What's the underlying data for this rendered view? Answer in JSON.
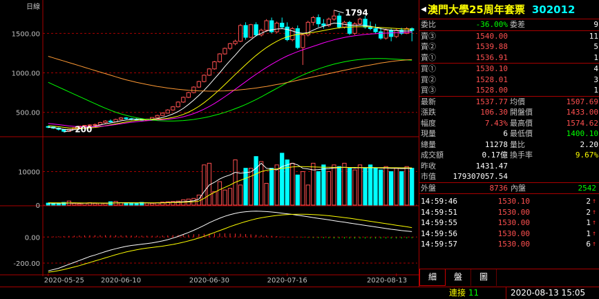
{
  "chart": {
    "period_label": "日線",
    "price_ticks": [
      "1500.00",
      "1000.00",
      "500.00"
    ],
    "volume_ticks": [
      "10000",
      "0"
    ],
    "macd_ticks": [
      "0.00",
      "-200.00"
    ],
    "date_ticks": [
      "2020-05-25",
      "2020-06-10",
      "2020-06-30",
      "2020-07-16",
      "2020-08-13"
    ],
    "high_label": "1794",
    "low_label": "200"
  },
  "chart_data": {
    "type": "candlestick",
    "price_ylim": [
      200,
      1800
    ],
    "candles": [
      [
        320,
        330,
        300,
        315
      ],
      [
        315,
        320,
        290,
        300
      ],
      [
        300,
        310,
        270,
        285
      ],
      [
        285,
        290,
        250,
        260
      ],
      [
        260,
        290,
        250,
        285
      ],
      [
        285,
        310,
        280,
        305
      ],
      [
        305,
        330,
        300,
        325
      ],
      [
        325,
        340,
        320,
        335
      ],
      [
        335,
        350,
        325,
        340
      ],
      [
        340,
        360,
        330,
        345
      ],
      [
        345,
        380,
        340,
        370
      ],
      [
        370,
        400,
        360,
        390
      ],
      [
        390,
        410,
        370,
        380
      ],
      [
        380,
        420,
        375,
        410
      ],
      [
        410,
        440,
        400,
        430
      ],
      [
        430,
        440,
        410,
        420
      ],
      [
        420,
        430,
        400,
        415
      ],
      [
        415,
        425,
        400,
        410
      ],
      [
        410,
        420,
        395,
        400
      ],
      [
        400,
        420,
        390,
        415
      ],
      [
        415,
        440,
        410,
        435
      ],
      [
        435,
        470,
        430,
        460
      ],
      [
        460,
        500,
        455,
        490
      ],
      [
        490,
        540,
        485,
        530
      ],
      [
        530,
        580,
        520,
        570
      ],
      [
        570,
        640,
        560,
        630
      ],
      [
        630,
        700,
        620,
        690
      ],
      [
        690,
        760,
        680,
        750
      ],
      [
        750,
        830,
        740,
        820
      ],
      [
        820,
        900,
        810,
        890
      ],
      [
        890,
        980,
        880,
        970
      ],
      [
        970,
        1060,
        960,
        1050
      ],
      [
        1050,
        1150,
        1040,
        1140
      ],
      [
        1140,
        1250,
        1130,
        1240
      ],
      [
        1240,
        1320,
        1230,
        1310
      ],
      [
        1310,
        1380,
        1290,
        1370
      ],
      [
        1370,
        1420,
        1350,
        1400
      ],
      [
        1400,
        1620,
        1390,
        1600
      ],
      [
        1600,
        1640,
        1420,
        1450
      ],
      [
        1450,
        1620,
        1440,
        1610
      ],
      [
        1610,
        1640,
        1460,
        1480
      ],
      [
        1480,
        1560,
        1460,
        1540
      ],
      [
        1540,
        1680,
        1520,
        1660
      ],
      [
        1660,
        1700,
        1500,
        1520
      ],
      [
        1520,
        1650,
        1500,
        1630
      ],
      [
        1630,
        1700,
        1560,
        1580
      ],
      [
        1580,
        1640,
        1400,
        1420
      ],
      [
        1420,
        1580,
        1400,
        1560
      ],
      [
        1560,
        1600,
        1300,
        1320
      ],
      [
        1320,
        1500,
        1100,
        1480
      ],
      [
        1480,
        1660,
        1460,
        1640
      ],
      [
        1640,
        1720,
        1600,
        1700
      ],
      [
        1700,
        1740,
        1580,
        1620
      ],
      [
        1620,
        1680,
        1560,
        1600
      ],
      [
        1600,
        1700,
        1580,
        1680
      ],
      [
        1680,
        1794,
        1660,
        1720
      ],
      [
        1720,
        1760,
        1560,
        1580
      ],
      [
        1580,
        1660,
        1560,
        1640
      ],
      [
        1640,
        1660,
        1480,
        1500
      ],
      [
        1500,
        1640,
        1480,
        1620
      ],
      [
        1620,
        1700,
        1600,
        1680
      ],
      [
        1680,
        1720,
        1560,
        1580
      ],
      [
        1580,
        1650,
        1540,
        1560
      ],
      [
        1560,
        1620,
        1500,
        1520
      ],
      [
        1520,
        1570,
        1420,
        1440
      ],
      [
        1440,
        1560,
        1420,
        1540
      ],
      [
        1540,
        1560,
        1400,
        1460
      ],
      [
        1460,
        1560,
        1440,
        1540
      ],
      [
        1540,
        1570,
        1480,
        1500
      ],
      [
        1500,
        1580,
        1490,
        1560
      ],
      [
        1560,
        1575,
        1400,
        1537
      ]
    ],
    "ma_lines": [
      {
        "color": "#ffffff",
        "values": [
          310,
          305,
          295,
          285,
          280,
          282,
          290,
          300,
          312,
          325,
          340,
          355,
          365,
          378,
          392,
          402,
          410,
          414,
          412,
          410,
          412,
          420,
          435,
          455,
          480,
          510,
          550,
          600,
          655,
          715,
          780,
          850,
          925,
          1000,
          1080,
          1155,
          1225,
          1300,
          1370,
          1420,
          1470,
          1500,
          1530,
          1545,
          1555,
          1560,
          1550,
          1530,
          1510,
          1500,
          1510,
          1540,
          1570,
          1590,
          1610,
          1630,
          1625,
          1615,
          1605,
          1600,
          1605,
          1600,
          1590,
          1575,
          1560,
          1550,
          1540,
          1535,
          1530,
          1530,
          1532
        ]
      },
      {
        "color": "#ffff00",
        "values": [
          330,
          325,
          318,
          310,
          302,
          298,
          296,
          298,
          302,
          308,
          318,
          330,
          342,
          354,
          366,
          378,
          390,
          398,
          404,
          408,
          410,
          412,
          416,
          424,
          436,
          452,
          474,
          502,
          536,
          576,
          622,
          674,
          730,
          790,
          852,
          916,
          980,
          1042,
          1104,
          1164,
          1220,
          1272,
          1320,
          1362,
          1400,
          1432,
          1456,
          1474,
          1486,
          1494,
          1502,
          1512,
          1524,
          1536,
          1548,
          1560,
          1570,
          1576,
          1580,
          1582,
          1584,
          1584,
          1582,
          1578,
          1574,
          1570,
          1566,
          1562,
          1558,
          1555,
          1552
        ]
      },
      {
        "color": "#ff00ff",
        "values": [
          360,
          352,
          344,
          336,
          328,
          322,
          318,
          316,
          316,
          318,
          322,
          328,
          336,
          345,
          355,
          365,
          374,
          382,
          388,
          394,
          398,
          402,
          406,
          412,
          420,
          430,
          444,
          462,
          484,
          510,
          540,
          574,
          612,
          654,
          698,
          744,
          792,
          840,
          888,
          936,
          982,
          1026,
          1068,
          1108,
          1146,
          1182,
          1214,
          1242,
          1268,
          1292,
          1314,
          1336,
          1358,
          1380,
          1400,
          1418,
          1434,
          1448,
          1460,
          1470,
          1478,
          1486,
          1492,
          1497,
          1500,
          1503,
          1506,
          1508,
          1510,
          1512,
          1514
        ]
      },
      {
        "color": "#00ff00",
        "values": [
          880,
          850,
          820,
          790,
          760,
          730,
          700,
          670,
          640,
          610,
          580,
          552,
          526,
          502,
          480,
          462,
          446,
          432,
          420,
          410,
          402,
          396,
          392,
          390,
          390,
          392,
          396,
          402,
          410,
          420,
          432,
          446,
          462,
          480,
          500,
          522,
          546,
          572,
          600,
          630,
          662,
          696,
          732,
          768,
          804,
          840,
          876,
          910,
          942,
          972,
          1000,
          1026,
          1050,
          1072,
          1092,
          1110,
          1126,
          1140,
          1152,
          1162,
          1170,
          1176,
          1180,
          1182,
          1182,
          1180,
          1176,
          1172,
          1168,
          1164,
          1160
        ]
      },
      {
        "color": "#ff9933",
        "values": [
          1210,
          1190,
          1170,
          1150,
          1130,
          1110,
          1090,
          1070,
          1050,
          1030,
          1010,
          990,
          970,
          950,
          930,
          912,
          896,
          880,
          866,
          852,
          840,
          828,
          818,
          808,
          800,
          792,
          786,
          780,
          776,
          772,
          770,
          768,
          768,
          770,
          772,
          776,
          780,
          786,
          792,
          800,
          808,
          818,
          828,
          840,
          852,
          864,
          878,
          892,
          906,
          920,
          934,
          948,
          962,
          976,
          990,
          1004,
          1018,
          1032,
          1046,
          1060,
          1074,
          1088,
          1100,
          1112,
          1124,
          1134,
          1144,
          1152,
          1158,
          1164,
          1168
        ]
      }
    ],
    "volume_ylim": [
      0,
      20000
    ],
    "volume": [
      600,
      500,
      400,
      800,
      1200,
      500,
      400,
      600,
      700,
      500,
      600,
      500,
      1000,
      1100,
      700,
      600,
      700,
      500,
      800,
      600,
      500,
      700,
      900,
      1000,
      1100,
      1200,
      1600,
      1800,
      2000,
      3000,
      12000,
      12500,
      4000,
      7000,
      4500,
      5000,
      13500,
      6000,
      11000,
      11000,
      14500,
      13000,
      6500,
      11000,
      12000,
      15500,
      13500,
      12500,
      9000,
      10000,
      6000,
      12500,
      10000,
      12000,
      10000,
      12000,
      11500,
      12500,
      11000,
      10500,
      12000,
      11000,
      12000,
      11000,
      10500,
      11500,
      10000,
      11000,
      10000,
      11500,
      11000
    ],
    "vol_ma_lines": [
      {
        "color": "#ffffff",
        "values": [
          600,
          580,
          560,
          580,
          600,
          620,
          580,
          560,
          600,
          620,
          580,
          560,
          600,
          650,
          700,
          720,
          700,
          680,
          700,
          650,
          620,
          640,
          700,
          780,
          850,
          920,
          1000,
          1120,
          1300,
          1800,
          4000,
          6000,
          6800,
          7800,
          8500,
          9000,
          9800,
          9500,
          9700,
          9900,
          11000,
          12500,
          11000,
          10800,
          10500,
          11500,
          12000,
          12500,
          12000,
          11000,
          10800,
          10500,
          10600,
          10800,
          10900,
          11100,
          11200,
          11300,
          11200,
          11100,
          11200,
          11150,
          11200,
          11150,
          11050,
          11100,
          11000,
          11000,
          10900,
          10950,
          10950
        ]
      },
      {
        "color": "#ffff00",
        "values": [
          700,
          680,
          660,
          640,
          650,
          660,
          640,
          620,
          630,
          640,
          620,
          600,
          620,
          640,
          660,
          680,
          690,
          690,
          690,
          680,
          670,
          670,
          690,
          720,
          760,
          800,
          850,
          920,
          1000,
          1200,
          2000,
          3000,
          3800,
          4600,
          5300,
          6000,
          6800,
          7400,
          8000,
          8600,
          9300,
          10000,
          10400,
          10600,
          10800,
          11000,
          11200,
          11400,
          11500,
          11500,
          11450,
          11400,
          11350,
          11300,
          11280,
          11260,
          11250,
          11250,
          11240,
          11230,
          11220,
          11210,
          11200,
          11190,
          11180,
          11170,
          11160,
          11150,
          11140,
          11130,
          11120
        ]
      }
    ],
    "macd_ylim": [
      -280,
      230
    ],
    "macd_dif": [
      -260,
      -250,
      -240,
      -225,
      -210,
      -195,
      -180,
      -165,
      -150,
      -138,
      -125,
      -112,
      -100,
      -90,
      -80,
      -72,
      -65,
      -60,
      -55,
      -50,
      -45,
      -38,
      -30,
      -20,
      -8,
      5,
      20,
      35,
      52,
      70,
      90,
      110,
      128,
      145,
      160,
      172,
      182,
      190,
      195,
      198,
      199,
      198,
      196,
      193,
      189,
      184,
      179,
      174,
      168,
      162,
      156,
      150,
      144,
      138,
      132,
      126,
      120,
      114,
      108,
      102,
      96,
      90,
      84,
      78,
      72,
      66,
      60,
      55,
      50,
      46,
      42
    ],
    "macd_dea": [
      -270,
      -265,
      -258,
      -250,
      -240,
      -230,
      -220,
      -208,
      -196,
      -184,
      -172,
      -160,
      -148,
      -136,
      -125,
      -115,
      -106,
      -98,
      -91,
      -85,
      -80,
      -75,
      -70,
      -64,
      -57,
      -49,
      -40,
      -30,
      -19,
      -7,
      6,
      20,
      35,
      50,
      65,
      80,
      94,
      107,
      119,
      130,
      140,
      148,
      155,
      161,
      166,
      170,
      173,
      175,
      176,
      176,
      175,
      173,
      171,
      168,
      164,
      160,
      155,
      150,
      145,
      139,
      133,
      127,
      121,
      115,
      109,
      103,
      97,
      91,
      85,
      79,
      73
    ],
    "macd_hist": [
      20,
      30,
      36,
      50,
      60,
      70,
      80,
      86,
      92,
      92,
      94,
      96,
      96,
      92,
      90,
      86,
      82,
      76,
      72,
      70,
      70,
      74,
      80,
      88,
      98,
      108,
      120,
      130,
      142,
      154,
      168,
      180,
      186,
      190,
      190,
      184,
      176,
      166,
      152,
      136,
      118,
      100,
      82,
      64,
      46,
      28,
      12,
      -2,
      -16,
      -28,
      -38,
      -46,
      -54,
      -60,
      -64,
      -68,
      -70,
      -72,
      -74,
      -74,
      -74,
      -74,
      -74,
      -74,
      -74,
      -74,
      -74,
      -72,
      -70,
      -66,
      -62
    ]
  },
  "panel": {
    "title_name": "澳門大學25周年套票",
    "title_code": "302012",
    "weibi": {
      "label": "委比",
      "value": "-36.00%",
      "label2": "委差",
      "value2": "9"
    },
    "sell": [
      {
        "label": "賣③",
        "price": "1540.00",
        "qty": "11"
      },
      {
        "label": "賣②",
        "price": "1539.88",
        "qty": "5"
      },
      {
        "label": "賣①",
        "price": "1536.91",
        "qty": "1"
      }
    ],
    "buy": [
      {
        "label": "買①",
        "price": "1530.10",
        "qty": "4"
      },
      {
        "label": "買②",
        "price": "1528.01",
        "qty": "3"
      },
      {
        "label": "買③",
        "price": "1528.00",
        "qty": "1"
      }
    ],
    "quote": [
      {
        "l1": "最新",
        "v1": "1537.77",
        "c1": "red",
        "l2": "均價",
        "v2": "1507.69",
        "c2": "red"
      },
      {
        "l1": "漲跌",
        "v1": "106.30",
        "c1": "red",
        "l2": "開盤價",
        "v2": "1433.00",
        "c2": "red"
      },
      {
        "l1": "幅度",
        "v1": "7.43%",
        "c1": "red",
        "l2": "最高價",
        "v2": "1574.62",
        "c2": "red"
      },
      {
        "l1": "現量",
        "v1": "6",
        "c1": "white",
        "l2": "最低價",
        "v2": "1400.10",
        "c2": "green"
      },
      {
        "l1": "總量",
        "v1": "11278",
        "c1": "white",
        "l2": "量比",
        "v2": "2.20",
        "c2": "white"
      },
      {
        "l1": "成交額",
        "v1": "0.17億",
        "c1": "white",
        "l2": "換手率",
        "v2": "9.67%",
        "c2": "yellow"
      }
    ],
    "prev_close": {
      "label": "昨收",
      "value": "1431.47"
    },
    "market_value": {
      "label": "市值",
      "value": "179307057.54"
    },
    "outer_inner": {
      "l1": "外盤",
      "v1": "8736",
      "l2": "內盤",
      "v2": "2542"
    },
    "ticks": [
      {
        "time": "14:59:46",
        "price": "1530.10",
        "qty": "2"
      },
      {
        "time": "14:59:51",
        "price": "1530.00",
        "qty": "2"
      },
      {
        "time": "14:59:55",
        "price": "1530.00",
        "qty": "1"
      },
      {
        "time": "14:59:56",
        "price": "1530.00",
        "qty": "1"
      },
      {
        "time": "14:59:57",
        "price": "1530.00",
        "qty": "6"
      }
    ],
    "tabs": [
      "細",
      "盤",
      "圖"
    ]
  },
  "status": {
    "conn_label": "連接",
    "conn_count": "11",
    "datetime": "2020-08-13 15:05"
  }
}
